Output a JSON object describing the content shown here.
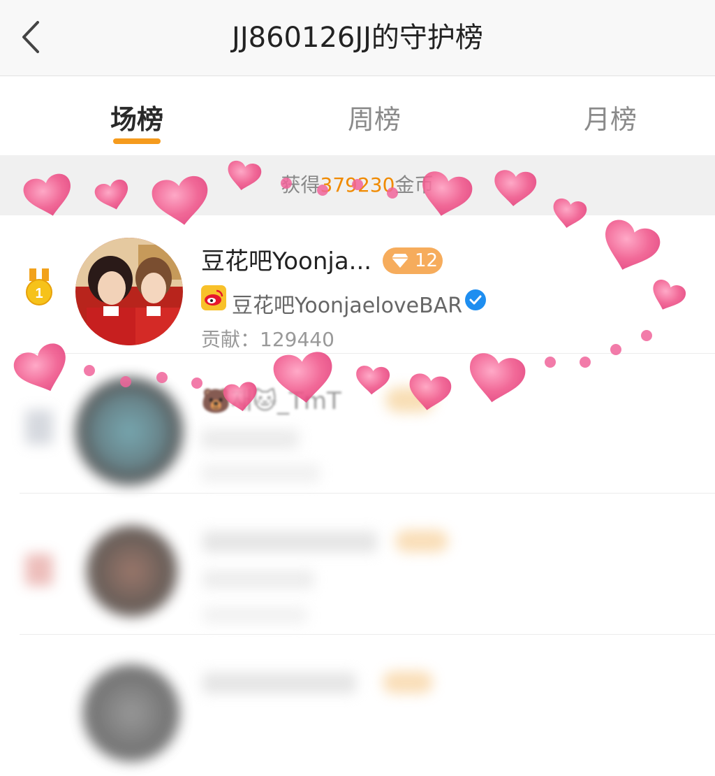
{
  "header": {
    "title": "JJ860126JJ的守护榜"
  },
  "tabs": [
    {
      "label": "场榜",
      "active": true
    },
    {
      "label": "周榜",
      "active": false
    },
    {
      "label": "月榜",
      "active": false
    }
  ],
  "summary": {
    "prefix": "获得",
    "amount": "379230",
    "suffix": "金币"
  },
  "ranking": [
    {
      "rank": "1",
      "name": "豆花吧Yoonja...",
      "level": "12",
      "sub_name": "豆花吧YoonjaeloveBAR",
      "contribution_label": "贡献：",
      "contribution": "129440"
    },
    {
      "name": "🐻재🐱_TmT"
    }
  ],
  "colors": {
    "accent": "#f59b1d",
    "amount": "#f08a00",
    "badge": "#f6ac5c",
    "verified": "#1e8ef0",
    "heart": "#f0558a"
  }
}
